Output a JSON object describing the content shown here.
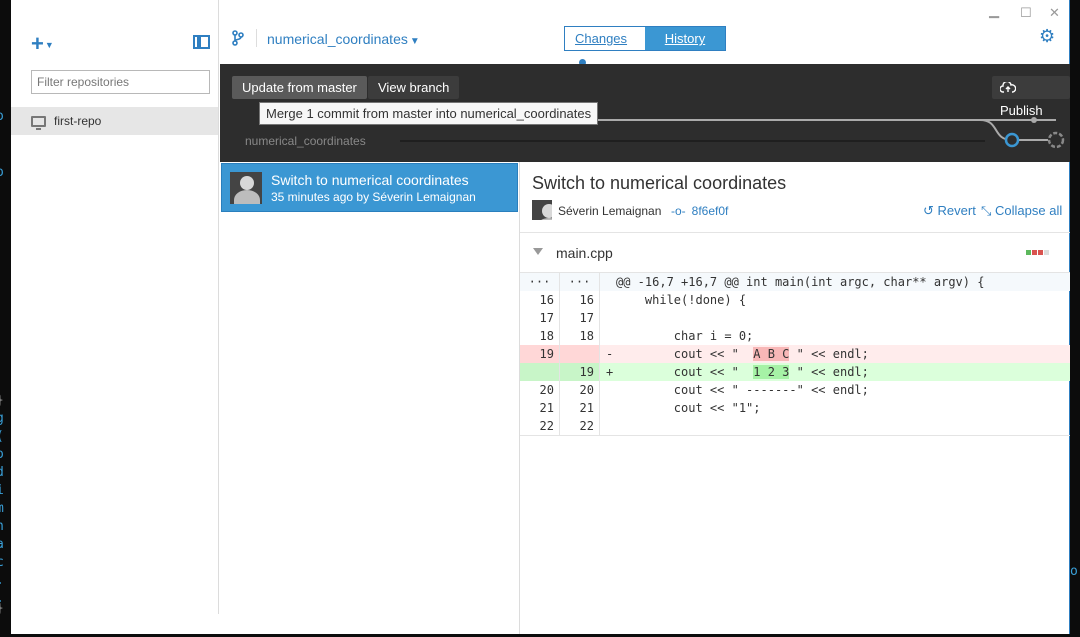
{
  "sidebar": {
    "filter_placeholder": "Filter repositories",
    "repos": [
      {
        "label": "first-repo"
      }
    ]
  },
  "header": {
    "branch": "numerical_coordinates",
    "tabs": {
      "changes": "Changes",
      "history": "History"
    }
  },
  "toolbar": {
    "update_label": "Update from master",
    "view_branch_label": "View branch",
    "publish_label": "Publish",
    "tooltip": "Merge 1 commit from master into numerical_coordinates",
    "graph_branch": "numerical_coordinates"
  },
  "commits": [
    {
      "title": "Switch to numerical coordinates",
      "meta": "35 minutes ago by Séverin Lemaignan"
    }
  ],
  "detail": {
    "title": "Switch to numerical coordinates",
    "author": "Séverin Lemaignan",
    "sha": "8f6ef0f",
    "revert_label": "Revert",
    "collapse_label": "Collapse all",
    "file": "main.cpp",
    "hunk_old": "···",
    "hunk_new": "···",
    "hunk_header": "@@ -16,7 +16,7 @@ int main(int argc, char** argv) {",
    "lines": [
      {
        "old": "16",
        "new": "16",
        "mark": "",
        "code": "    while(!done) {"
      },
      {
        "old": "17",
        "new": "17",
        "mark": "",
        "code": ""
      },
      {
        "old": "18",
        "new": "18",
        "mark": "",
        "code": "        char i = 0;"
      },
      {
        "old": "19",
        "new": "",
        "mark": "-",
        "pre": "        cout << \"  ",
        "hl": "A B C",
        "post": " \" << endl;"
      },
      {
        "old": "",
        "new": "19",
        "mark": "+",
        "pre": "        cout << \"  ",
        "hl": "1 2 3",
        "post": " \" << endl;"
      },
      {
        "old": "20",
        "new": "20",
        "mark": "",
        "code": "        cout << \" -------\" << endl;"
      },
      {
        "old": "21",
        "new": "21",
        "mark": "",
        "code": "        cout << \"1\";"
      },
      {
        "old": "22",
        "new": "22",
        "mark": "",
        "code": ""
      }
    ]
  },
  "colors": {
    "accent": "#3b97d3",
    "link": "#2f7fc1",
    "dark_toolbar": "#2d2d2d",
    "deleted": "#ffecec",
    "added": "#dbffdb"
  }
}
